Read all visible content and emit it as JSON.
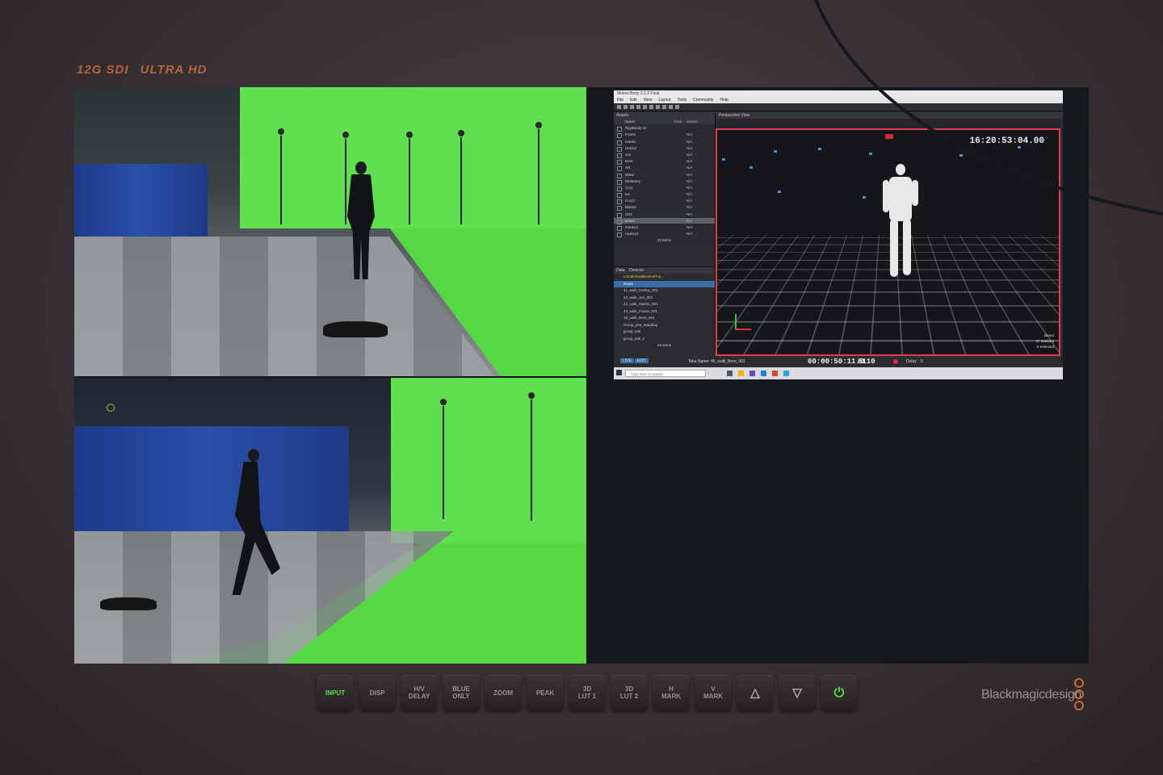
{
  "monitor": {
    "model_badge": "12G SDI",
    "model_text": "ULTRA HD",
    "brand": "Blackmagicdesign"
  },
  "mocap_app": {
    "title": "Motive:Body 2.1.2 Final",
    "menu": [
      "File",
      "Edit",
      "View",
      "Layout",
      "Tools",
      "Community",
      "Help"
    ],
    "assets_panel": {
      "title": "Assets",
      "columns": [
        "Name",
        "Kind",
        "Solved"
      ],
      "rows": [
        {
          "name": "RigidBody 02",
          "status": "",
          "kind": ""
        },
        {
          "name": "Frame",
          "status": "N/A",
          "kind": ""
        },
        {
          "name": "Kweku",
          "status": "N/A",
          "kind": ""
        },
        {
          "name": "Hanley",
          "status": "N/A",
          "kind": ""
        },
        {
          "name": "Jon",
          "status": "N/A",
          "kind": ""
        },
        {
          "name": "Bree",
          "status": "N/A",
          "kind": ""
        },
        {
          "name": "AR",
          "status": "N/A",
          "kind": ""
        },
        {
          "name": "Blake",
          "status": "N/A",
          "kind": ""
        },
        {
          "name": "Wellesley",
          "status": "N/A",
          "kind": ""
        },
        {
          "name": "Cory",
          "status": "N/A",
          "kind": ""
        },
        {
          "name": "Ian",
          "status": "N/A",
          "kind": ""
        },
        {
          "name": "Cory2",
          "status": "N/A",
          "kind": ""
        },
        {
          "name": "Blake2",
          "status": "N/A",
          "kind": ""
        },
        {
          "name": "AR2",
          "status": "N/A",
          "kind": ""
        },
        {
          "name": "Bree2",
          "status": "N/A",
          "kind": "",
          "selected": true
        },
        {
          "name": "Kweku2",
          "status": "N/A",
          "kind": ""
        },
        {
          "name": "Hanley2",
          "status": "N/A",
          "kind": ""
        }
      ],
      "footer": "23 items"
    },
    "data_panel": {
      "tabs": [
        "Data",
        "Devices"
      ],
      "project": "LACatchwalkDemoProj...",
      "column": "Name",
      "takes": [
        "41_walk_Hanley_001",
        "42_walk_Jon_001",
        "43_walk_Kweku_001",
        "44_walk_Frame_001",
        "45_walk_Bree_001",
        "Group_ph4_standing",
        "group_talk",
        "group_talk_2"
      ],
      "footer": "55 items"
    },
    "viewport": {
      "title": "Perspective View",
      "timecode": "16:20:53:04.00",
      "stats": [
        "Bree2",
        "37 Markers",
        "0 Selected"
      ]
    },
    "bottom_bar": {
      "mode_live": "LIVE",
      "mode_edit": "EDIT",
      "take_label": "Take Name:",
      "take_name": "45_walk_Bree_001",
      "timecode": "00:00:50:11.0",
      "frame": "6110",
      "delay_label": "Delay:",
      "delay_value": "0"
    },
    "taskbar": {
      "search_placeholder": "Type here to search"
    }
  },
  "controls": [
    {
      "label": "INPUT",
      "active": true
    },
    {
      "label": "DISP"
    },
    {
      "label": "H/V DELAY"
    },
    {
      "label": "BLUE ONLY"
    },
    {
      "label": "ZOOM"
    },
    {
      "label": "PEAK"
    },
    {
      "label": "3D LUT 1"
    },
    {
      "label": "3D LUT 2"
    },
    {
      "label": "H MARK"
    },
    {
      "label": "V MARK"
    },
    {
      "label": "△"
    },
    {
      "label": "▽"
    },
    {
      "label": "⏻"
    }
  ],
  "colors": {
    "accent_green": "#56e04a",
    "brand_orange": "#c96c37",
    "viewport_border": "#e23b4e"
  }
}
